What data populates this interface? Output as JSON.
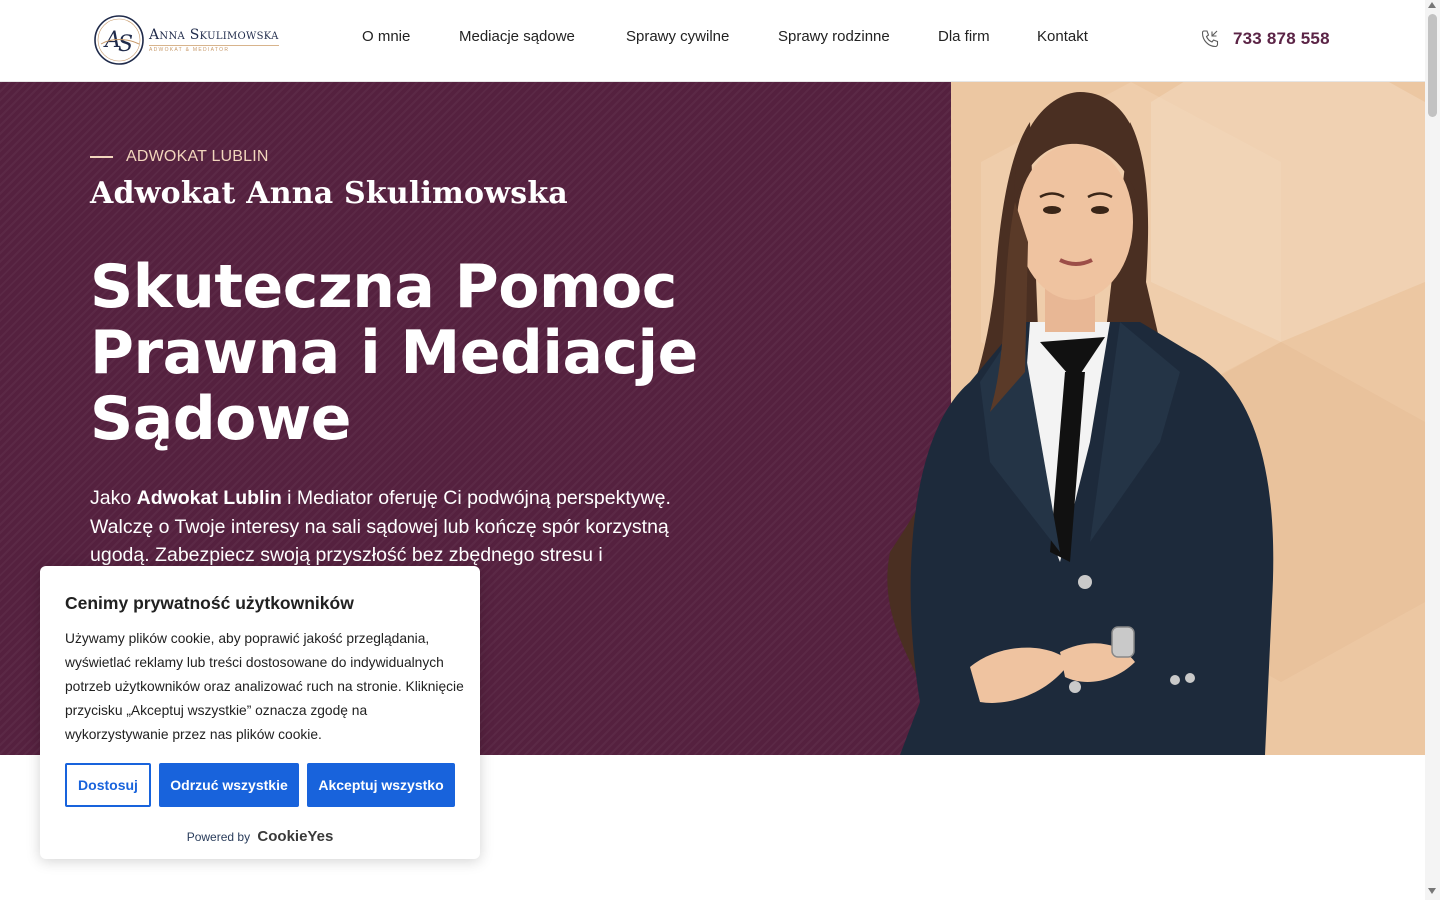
{
  "header": {
    "logo": {
      "monogram": "AS",
      "name": "Anna Skulimowska",
      "tagline": "Adwokat & Mediator"
    },
    "nav": [
      {
        "label": "O mnie"
      },
      {
        "label": "Mediacje sądowe"
      },
      {
        "label": "Sprawy cywilne"
      },
      {
        "label": "Sprawy rodzinne"
      },
      {
        "label": "Dla firm"
      },
      {
        "label": "Kontakt"
      }
    ],
    "phone": {
      "icon": "phone-icon",
      "number": "733 878 558"
    }
  },
  "hero": {
    "eyebrow": "ADWOKAT LUBLIN",
    "subtitle": "Adwokat Anna Skulimowska",
    "headline": "Skuteczna Pomoc Prawna i Mediacje Sądowe",
    "lead_pre": "Jako ",
    "lead_bold": "Adwokat Lublin",
    "lead_post": " i Mediator oferuję Ci podwójną perspektywę. Walczę o Twoje interesy na sali sądowej lub kończę spór korzystną ugodą. Zabezpiecz swoją przyszłość bez zbędnego stresu i",
    "image": "portrait-photo"
  },
  "cookie_banner": {
    "title": "Cenimy prywatność użytkowników",
    "text": "Używamy plików cookie, aby poprawić jakość przeglądania, wyświetlać reklamy lub treści dostosowane do indywidualnych potrzeb użytkowników oraz analizować ruch na stronie. Kliknięcie przycisku „Akceptuj wszystkie” oznacza zgodę na wykorzystywanie przez nas plików cookie.",
    "buttons": {
      "customize": "Dostosuj",
      "reject": "Odrzuć wszystkie",
      "accept": "Akceptuj wszystko"
    },
    "powered_by": "Powered by",
    "brand": "CookieYes"
  },
  "colors": {
    "brand_plum": "#55213f",
    "accent_peach": "#ecc7a2",
    "cookie_blue": "#1863dc"
  }
}
